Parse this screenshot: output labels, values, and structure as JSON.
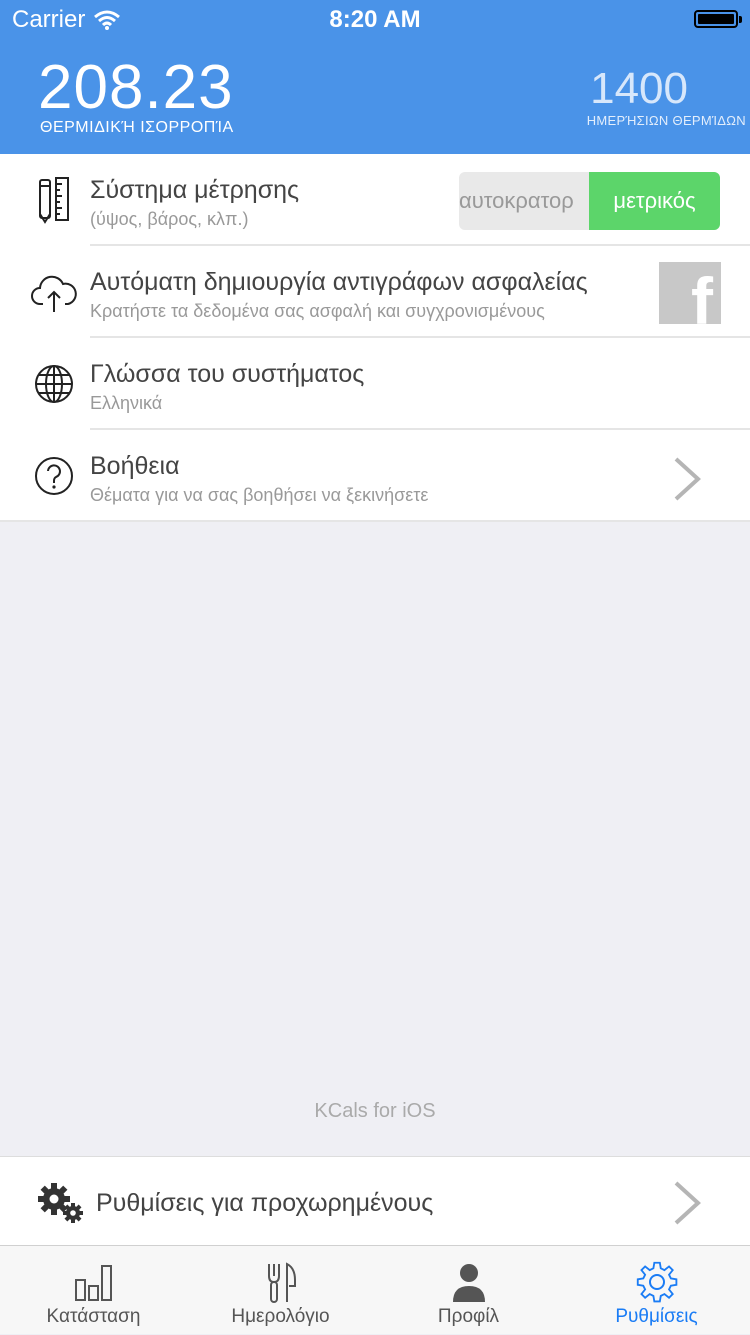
{
  "status_bar": {
    "carrier": "Carrier",
    "time": "8:20 AM"
  },
  "header": {
    "balance_value": "208.23",
    "balance_label": "ΘΕΡΜΙΔΙΚΉ ΙΣΟΡΡΟΠΊΑ",
    "daily_value": "1400",
    "daily_label": "ΗΜΕΡΉΣΙΩΝ ΘΕΡΜΊΔΩΝ"
  },
  "settings": {
    "measurement": {
      "title": "Σύστημα μέτρησης",
      "subtitle": "(ύψος, βάρος, κλπ.)",
      "options": [
        "αυτοκρατορ",
        "μετρικός"
      ],
      "selected": "μετρικός"
    },
    "backup": {
      "title": "Αυτόματη δημιουργία αντιγράφων ασφαλείας",
      "subtitle": "Κρατήστε τα δεδομένα σας ασφαλή και συγχρονισμένους",
      "service_label": "f"
    },
    "language": {
      "title": "Γλώσσα του συστήματος",
      "subtitle": "Ελληνικά"
    },
    "help": {
      "title": "Βοήθεια",
      "subtitle": "Θέματα για να σας βοηθήσει να ξεκινήσετε"
    }
  },
  "footer_note": "KCals for iOS",
  "advanced": {
    "label": "Ρυθμίσεις για προχωρημένους"
  },
  "tabs": [
    {
      "label": "Κατάσταση",
      "icon": "chart-icon"
    },
    {
      "label": "Ημερολόγιο",
      "icon": "fork-knife-icon"
    },
    {
      "label": "Προφίλ",
      "icon": "person-icon"
    },
    {
      "label": "Ρυθμίσεις",
      "icon": "gear-icon",
      "active": true
    }
  ],
  "colors": {
    "header": "#4a93e8",
    "segment_selected": "#5cd56a",
    "tab_active": "#1a7cf5",
    "background": "#efeff4"
  }
}
